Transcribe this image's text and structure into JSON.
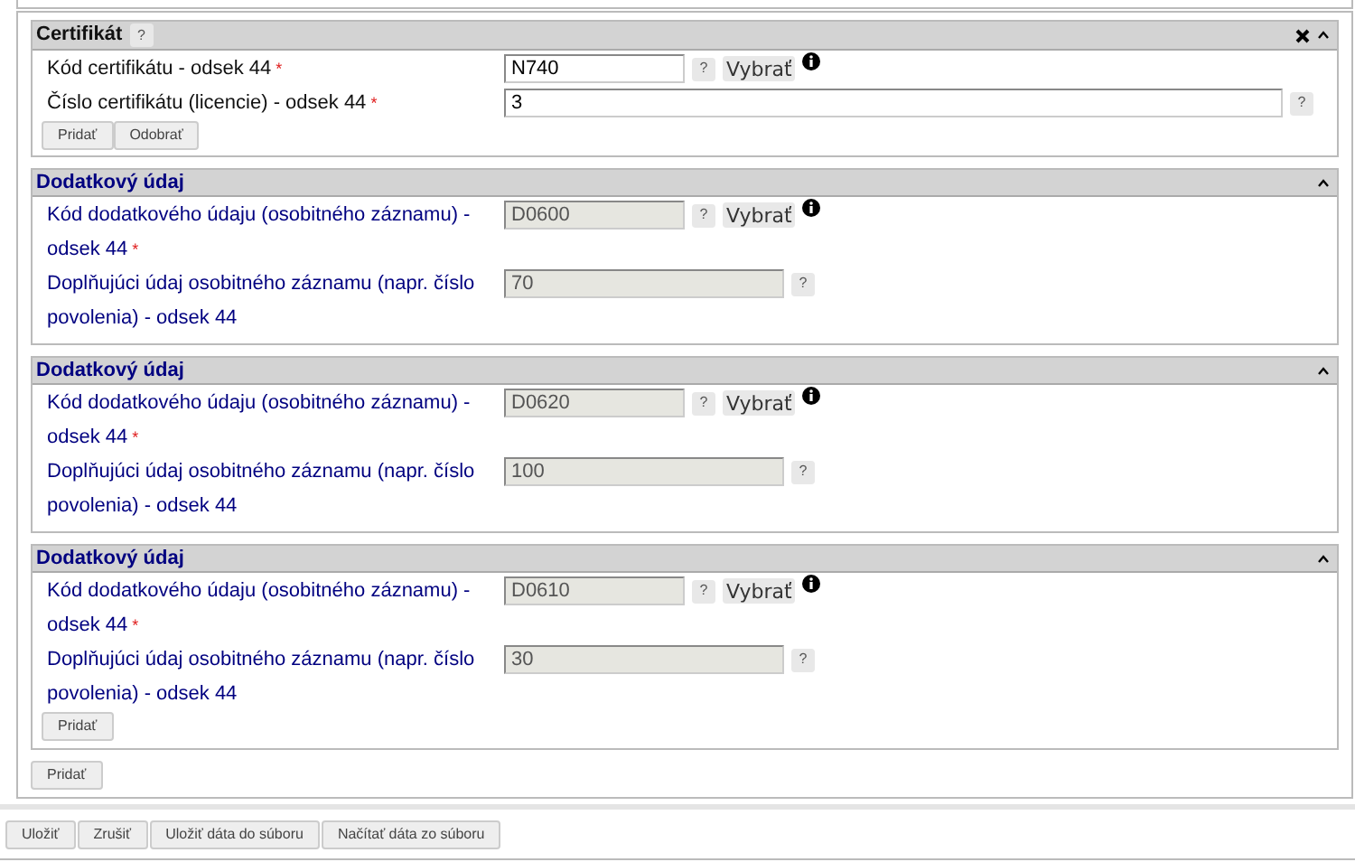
{
  "certificate": {
    "title": "Certifikát",
    "help": "?",
    "closable": true,
    "collapsed": false,
    "fields": [
      {
        "label": "Kód certifikátu - odsek 44",
        "required_mark": "*",
        "value": "N740",
        "disabled": false,
        "kind": "short",
        "help": "?",
        "select": "Vybrať",
        "info": true
      },
      {
        "label": "Číslo certifikátu (licencie) - odsek 44",
        "required_mark": "*",
        "value": "3",
        "disabled": false,
        "kind": "long",
        "help": "?"
      }
    ],
    "buttons": [
      "Pridať",
      "Odobrať"
    ]
  },
  "supplementary": [
    {
      "title": "Dodatkový údaj",
      "collapsed": false,
      "fields": [
        {
          "label": "Kód dodatkového údaju (osobitného záznamu) - odsek 44",
          "required_mark": "*",
          "value": "D0600",
          "disabled": true,
          "kind": "short",
          "help": "?",
          "select": "Vybrať",
          "info": true
        },
        {
          "label": "Doplňujúci údaj osobitného záznamu (napr. číslo povolenia) - odsek 44",
          "value": "70",
          "disabled": true,
          "kind": "medium",
          "help": "?"
        }
      ]
    },
    {
      "title": "Dodatkový údaj",
      "collapsed": false,
      "fields": [
        {
          "label": "Kód dodatkového údaju (osobitného záznamu) - odsek 44",
          "required_mark": "*",
          "value": "D0620",
          "disabled": true,
          "kind": "short",
          "help": "?",
          "select": "Vybrať",
          "info": true
        },
        {
          "label": "Doplňujúci údaj osobitného záznamu (napr. číslo povolenia) - odsek 44",
          "value": "100",
          "disabled": true,
          "kind": "medium",
          "help": "?"
        }
      ]
    },
    {
      "title": "Dodatkový údaj",
      "collapsed": false,
      "fields": [
        {
          "label": "Kód dodatkového údaju (osobitného záznamu) - odsek 44",
          "required_mark": "*",
          "value": "D0610",
          "disabled": true,
          "kind": "short",
          "help": "?",
          "select": "Vybrať",
          "info": true
        },
        {
          "label": "Doplňujúci údaj osobitného záznamu (napr. číslo povolenia) - odsek 44",
          "value": "30",
          "disabled": true,
          "kind": "medium",
          "help": "?"
        }
      ],
      "buttons": [
        "Pridať"
      ]
    }
  ],
  "outer_button": "Pridať",
  "footer_buttons": [
    "Uložiť",
    "Zrušiť",
    "Uložiť dáta do súboru",
    "Načítať dáta zo súboru"
  ]
}
